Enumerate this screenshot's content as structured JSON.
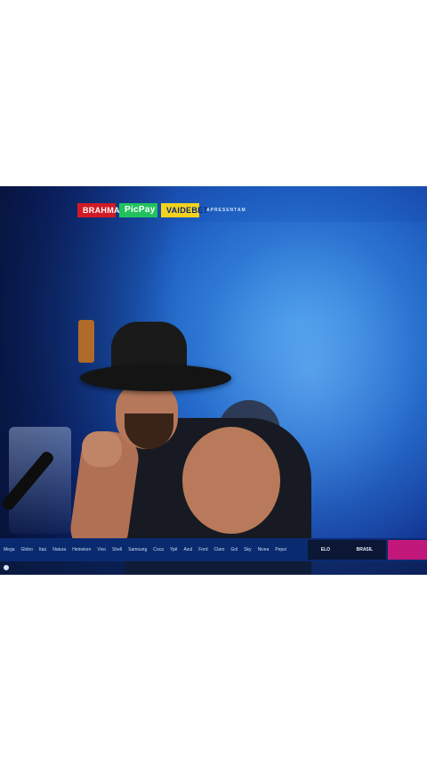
{
  "video": {
    "sponsors": [
      "BRAHMA",
      "PicPay",
      "VAIDEBET",
      "APRESENTAM"
    ],
    "partners": [
      "Mega",
      "Globo",
      "Itaú",
      "Natura",
      "Heineken",
      "Vivo",
      "Shell",
      "Samsung",
      "Coca",
      "Ypê",
      "Azul",
      "Ford",
      "Claro",
      "Gol",
      "Sky",
      "Nivea",
      "Pepsi"
    ],
    "banner_dark": [
      "ELO",
      "BRASIL"
    ]
  },
  "colors": {
    "brahma": "#d11a25",
    "picpay": "#21c25e",
    "vaidebet": "#f4d21e",
    "bar": "#0a2a70"
  }
}
